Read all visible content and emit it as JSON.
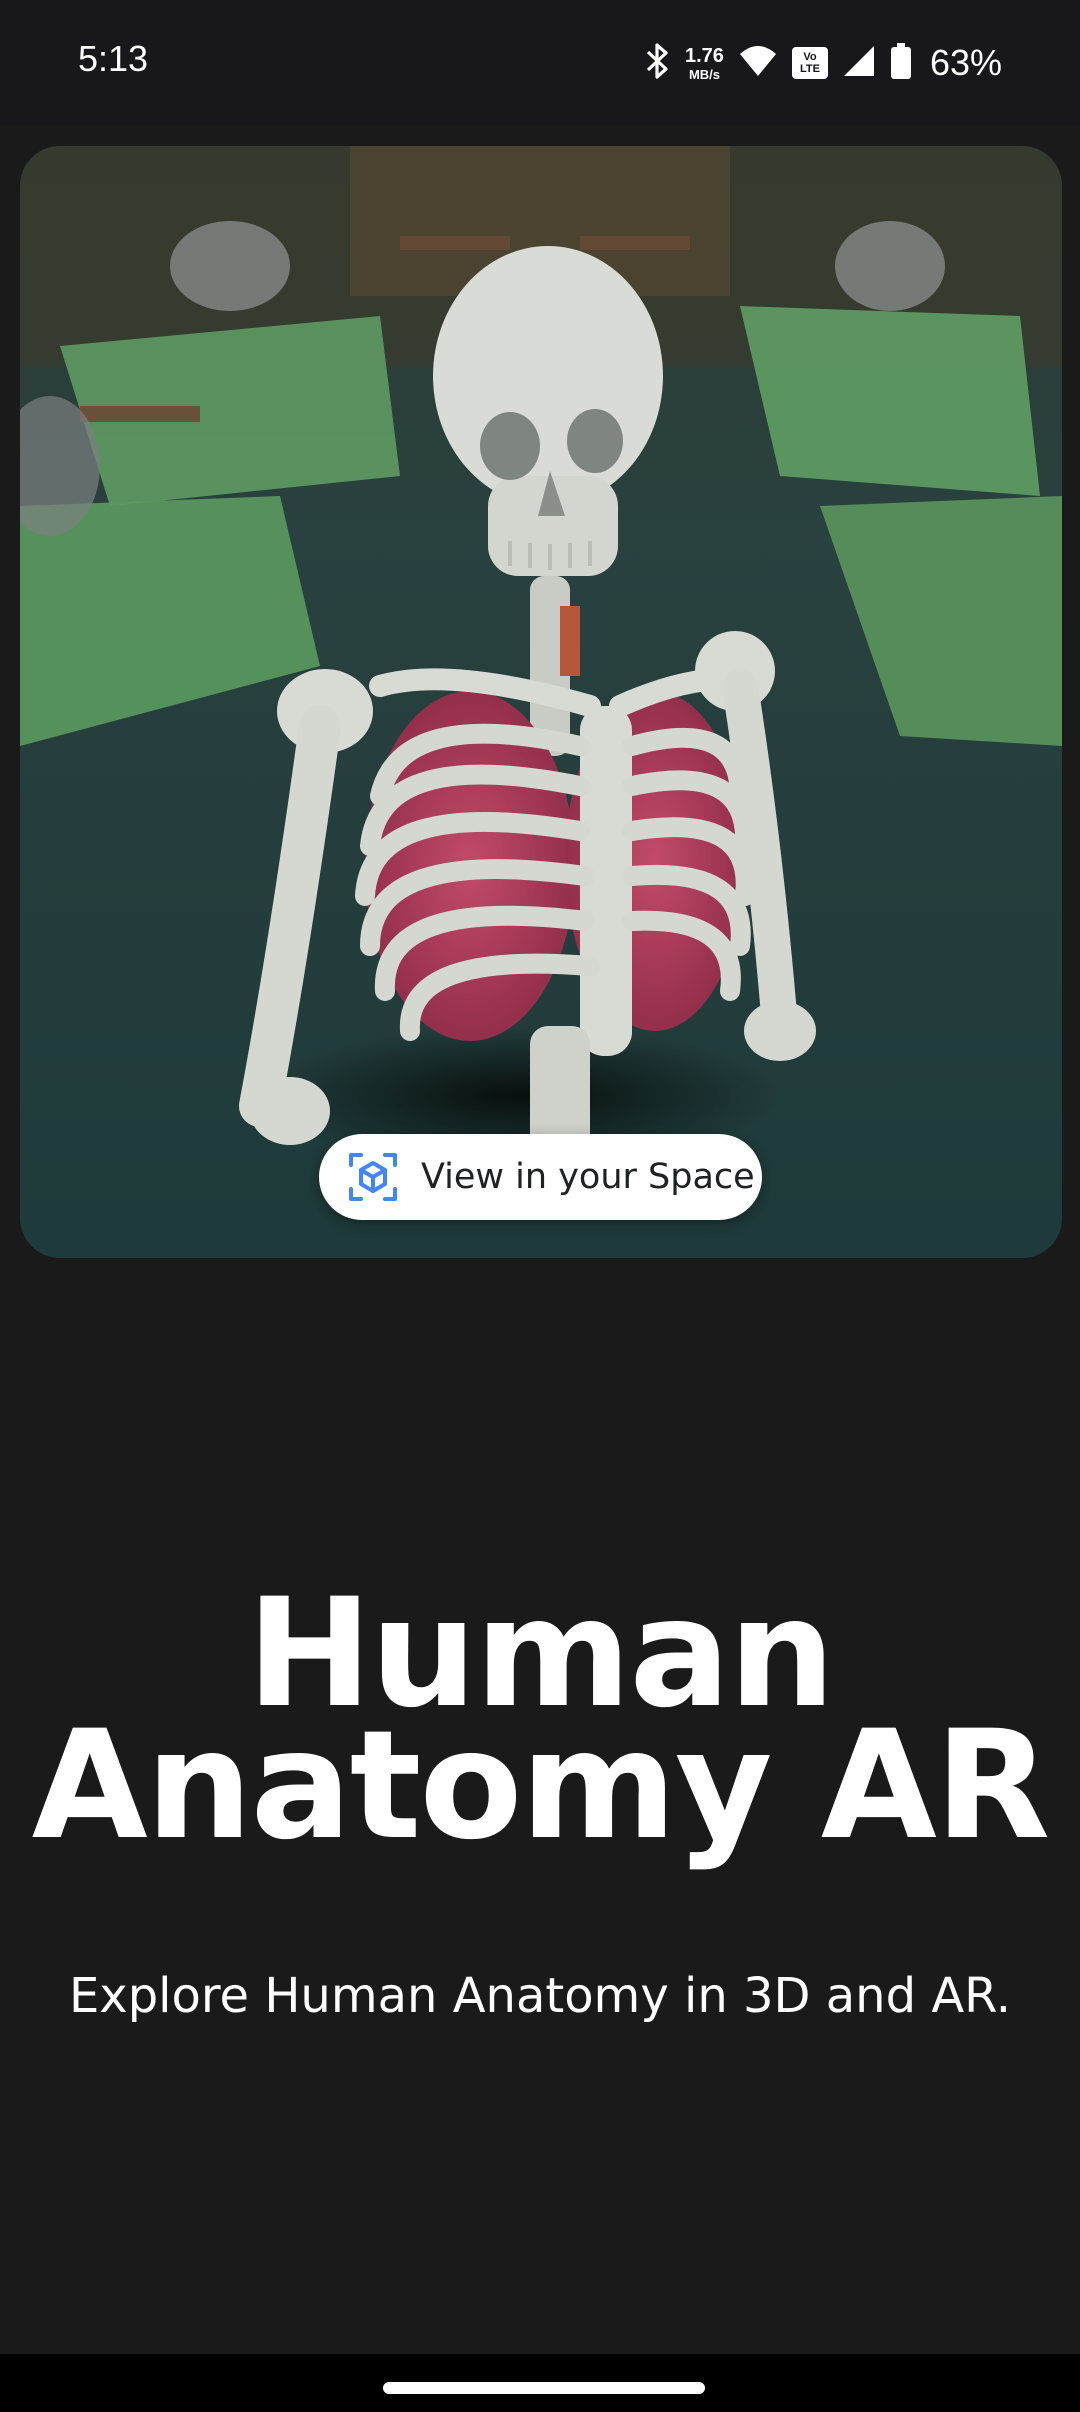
{
  "status_bar": {
    "time": "5:13",
    "net_speed_value": "1.76",
    "net_speed_unit": "MB/s",
    "volte_top": "Vo",
    "volte_bottom": "LTE",
    "battery_percent": "63%",
    "icons": [
      "bluetooth-icon",
      "wifi-icon",
      "volte-icon",
      "signal-icon",
      "battery-icon"
    ]
  },
  "hero": {
    "image": "skeleton-ar-preview",
    "ar_button_label": "View in your Space",
    "ar_button_icon": "ar-cube-icon",
    "accent_color": "#4285f4"
  },
  "main": {
    "title_line1": "Human",
    "title_line2": "Anatomy AR",
    "subtitle": "Explore Human Anatomy in 3D and AR."
  },
  "colors": {
    "background": "#1a1a1a",
    "status_bar": "#17171c",
    "nav_bar": "#000000"
  }
}
